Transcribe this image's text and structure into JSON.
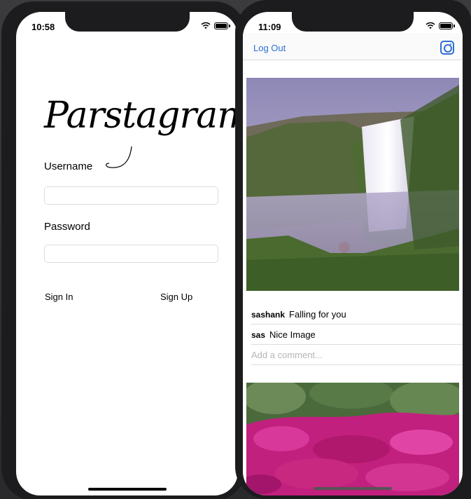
{
  "login_screen": {
    "status_time": "10:58",
    "logo_text": "Parstagram",
    "username_label": "Username",
    "password_label": "Password",
    "sign_in_label": "Sign In",
    "sign_up_label": "Sign Up"
  },
  "feed_screen": {
    "status_time": "11:09",
    "logout_label": "Log Out",
    "camera_icon": "camera-icon",
    "post1": {
      "image": "waterfall-photo",
      "comments": [
        {
          "user": "sashank",
          "text": "Falling for you"
        },
        {
          "user": "sas",
          "text": "Nice Image"
        }
      ],
      "comment_placeholder": "Add a comment..."
    },
    "post2": {
      "image": "pink-flowers-photo"
    }
  },
  "colors": {
    "link_blue": "#2f6fd6",
    "divider": "#dcdcdc",
    "device_frame": "#1c1c1e"
  }
}
